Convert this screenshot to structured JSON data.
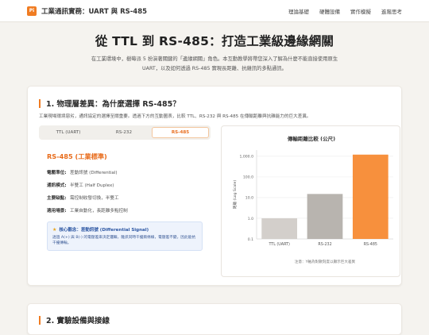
{
  "header": {
    "logo_text": "Pi",
    "brand": "工業通訊實務：UART 與 RS-485",
    "nav": [
      "理論基礎",
      "硬體設備",
      "實作模擬",
      "進階思考"
    ]
  },
  "hero": {
    "title": "從 TTL 到 RS-485：打造工業級邊緣網關",
    "intro": "在工業環境中，樹莓派 5 扮演著關鍵的「邊緣網關」角色。本互動教學將帶您深入了解為什麼不能直接使用原生 UART，以及如何透過 RS-485 實現長距離、抗雜訊的多點通訊。"
  },
  "section1": {
    "title": "1. 物理層差異：為什麼選擇 RS-485？",
    "desc": "工業現場環境惡劣，通訊協定的選擇至關重要。透過下方的互動圖表，比較 TTL、RS-232 與 RS-485 在傳輸距離與抗雜能力的巨大差異。",
    "tabs": [
      "TTL (UART)",
      "RS-232",
      "RS-485"
    ],
    "selected_tab": "RS-485",
    "detail": {
      "title": "RS-485 (工業標準)",
      "rows": [
        {
          "k": "電壓準位:",
          "v": "差動訊號 (Differential)"
        },
        {
          "k": "通訊模式:",
          "v": "半雙工 (Half Duplex)"
        },
        {
          "k": "主要缺點:",
          "v": "需控制收發切換，半雙工"
        },
        {
          "k": "適用場景:",
          "v": "工業自動化，長距離多點控制"
        }
      ],
      "note_title": "核心觀念：差動訊號 (Differential Signal)",
      "note_body": "透過 A(+) 與 B(-) 的電壓差來決定邏輯，雜訊同時干擾兩條線，電壓差不變，因此能抗干擾傳輸。"
    }
  },
  "chart_data": {
    "type": "bar",
    "title": "傳輸距離比較 (公尺)",
    "categories": [
      "TTL (UART)",
      "RS-232",
      "RS-485"
    ],
    "values": [
      1,
      15,
      1200
    ],
    "ylabel": "距離 (Log Scale)",
    "yscale": "log",
    "ylim": [
      0.1,
      2000
    ],
    "yticks": [
      "0.1",
      "1.0",
      "10.0",
      "100.0",
      "1,000.0"
    ],
    "footnote": "注意：Y軸為對數刻度以顯示巨大差異",
    "colors": [
      "#d3cfcb",
      "#b8b4af",
      "#f7903d"
    ],
    "grid": true
  },
  "section2": {
    "title": "2. 實驗設備與接線"
  }
}
